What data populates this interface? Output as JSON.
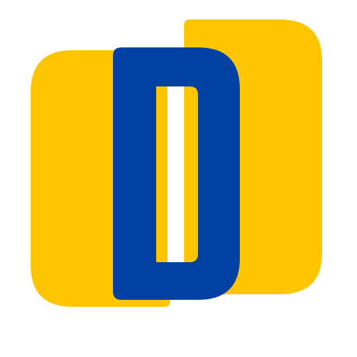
{
  "logo": {
    "icon": "letter-d-logo-icon",
    "letter": "D",
    "colors": {
      "background": "#ffffff",
      "primary_yellow": "#FFC600",
      "primary_blue": "#0041A1",
      "highlight": "#ffffff"
    }
  }
}
